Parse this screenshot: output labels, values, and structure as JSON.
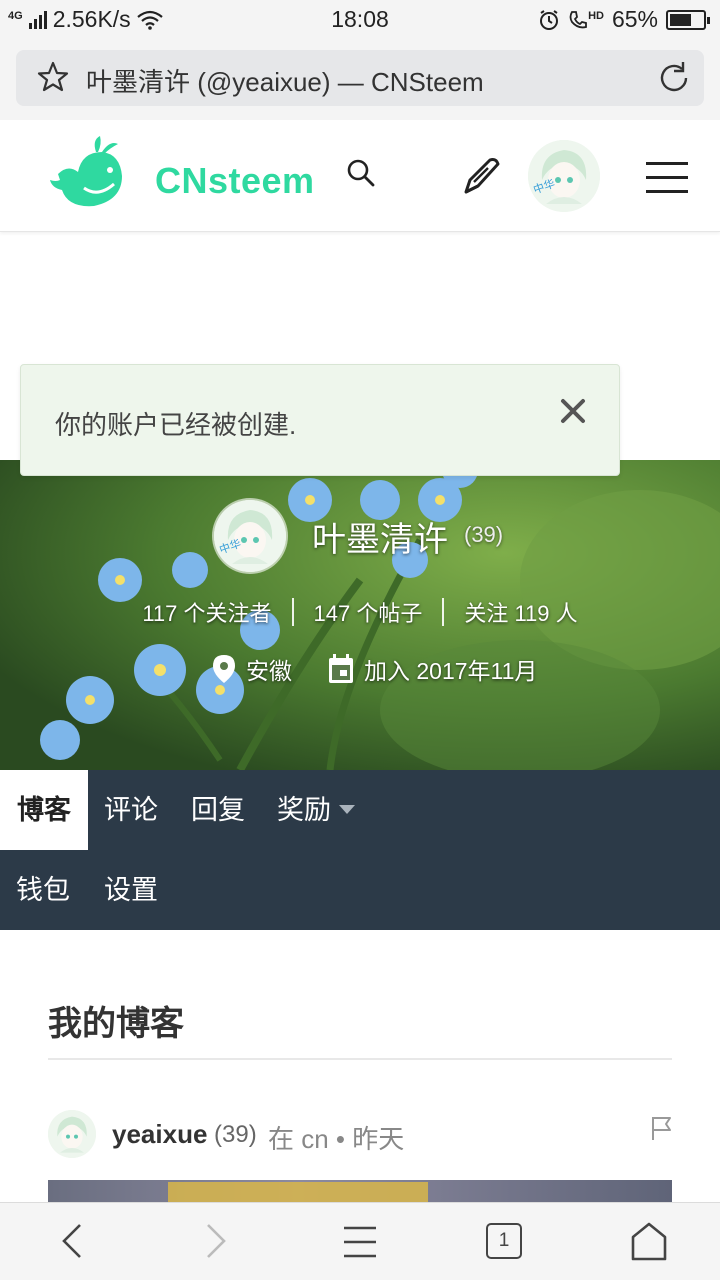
{
  "status_bar": {
    "network": "4G",
    "speed": "2.56K/s",
    "time": "18:08",
    "volte": "HD",
    "battery": "65%",
    "battery_level": 0.65
  },
  "browser": {
    "page_title": "叶墨清许 (@yeaixue) — CNSteem"
  },
  "site": {
    "brand": "CNsteem",
    "accent_color": "#2fd9a0",
    "icons": [
      "whale-logo-icon",
      "search-icon",
      "pen-icon",
      "avatar",
      "hamburger-menu-icon"
    ]
  },
  "notice": {
    "message": "你的账户已经被创建."
  },
  "profile": {
    "display_name": "叶墨清许",
    "reputation": "(39)",
    "followers": "117 个关注者",
    "posts": "147 个帖子",
    "following": "关注 119 人",
    "location": "安徽",
    "joined": "加入 2017年11月"
  },
  "tabs": {
    "blog": "博客",
    "comments": "评论",
    "replies": "回复",
    "rewards": "奖励",
    "wallet": "钱包",
    "settings": "设置"
  },
  "content": {
    "section_title": "我的博客",
    "post": {
      "author": "yeaixue",
      "reputation": "(39)",
      "in_label": "在 cn • 昨天"
    }
  },
  "bottom_nav": {
    "tab_count": "1"
  }
}
